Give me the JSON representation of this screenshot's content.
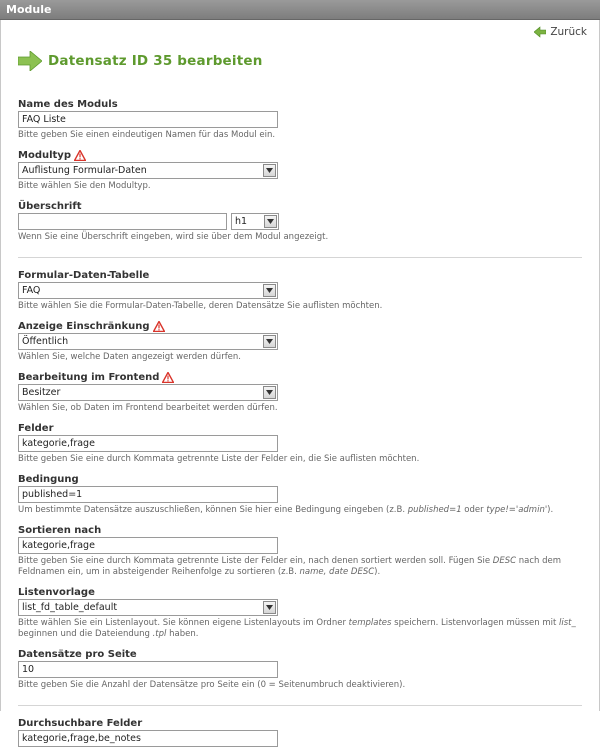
{
  "panel": {
    "title": "Module"
  },
  "back": {
    "label": "Zurück"
  },
  "page": {
    "title": "Datensatz ID 35 bearbeiten"
  },
  "fields": {
    "name": {
      "label": "Name des Moduls",
      "value": "FAQ Liste",
      "hint": "Bitte geben Sie einen eindeutigen Namen für das Modul ein."
    },
    "modultyp": {
      "label": "Modultyp",
      "value": "Auflistung Formular-Daten",
      "hint": "Bitte wählen Sie den Modultyp."
    },
    "ueberschrift": {
      "label": "Überschrift",
      "value": "",
      "level": "h1",
      "hint": "Wenn Sie eine Überschrift eingeben, wird sie über dem Modul angezeigt."
    },
    "tabelle": {
      "label": "Formular-Daten-Tabelle",
      "value": "FAQ",
      "hint": "Bitte wählen Sie die Formular-Daten-Tabelle, deren Datensätze Sie auflisten möchten."
    },
    "einschraenkung": {
      "label": "Anzeige Einschränkung",
      "value": "Öffentlich",
      "hint": "Wählen Sie, welche Daten angezeigt werden dürfen."
    },
    "bearbeitung": {
      "label": "Bearbeitung im Frontend",
      "value": "Besitzer",
      "hint": "Wählen Sie, ob Daten im Frontend bearbeitet werden dürfen."
    },
    "felder": {
      "label": "Felder",
      "value": "kategorie,frage",
      "hint": "Bitte geben Sie eine durch Kommata getrennte Liste der Felder ein, die Sie auflisten möchten."
    },
    "bedingung": {
      "label": "Bedingung",
      "value": "published=1",
      "hint_pre": "Um bestimmte Datensätze auszuschließen, können Sie hier eine Bedingung eingeben (z.B. ",
      "hint_em1": "published=1",
      "hint_mid": " oder ",
      "hint_em2": "type!='admin'",
      "hint_post": ")."
    },
    "sortieren": {
      "label": "Sortieren nach",
      "value": "kategorie,frage",
      "hint_pre": "Bitte geben Sie eine durch Kommata getrennte Liste der Felder ein, nach denen sortiert werden soll. Fügen Sie ",
      "hint_em1": "DESC",
      "hint_mid": " nach dem Feldnamen ein, um in absteigender Reihenfolge zu sortieren (z.B. ",
      "hint_em2": "name, date DESC",
      "hint_post": ")."
    },
    "listenvorlage": {
      "label": "Listenvorlage",
      "value": "list_fd_table_default",
      "hint_pre": "Bitte wählen Sie ein Listenlayout. Sie können eigene Listenlayouts im Ordner ",
      "hint_em1": "templates",
      "hint_mid": " speichern. Listenvorlagen müssen mit ",
      "hint_em2": "list_",
      "hint_mid2": " beginnen und die Dateiendung ",
      "hint_em3": ".tpl",
      "hint_post": " haben."
    },
    "proseite": {
      "label": "Datensätze pro Seite",
      "value": "10",
      "hint": "Bitte geben Sie die Anzahl der Datensätze pro Seite ein (0 = Seitenumbruch deaktivieren)."
    },
    "durchsuchbar": {
      "label": "Durchsuchbare Felder",
      "value": "kategorie,frage,be_notes"
    }
  },
  "colors": {
    "accent": "#5e9a2e",
    "warning": "#d9342b"
  }
}
